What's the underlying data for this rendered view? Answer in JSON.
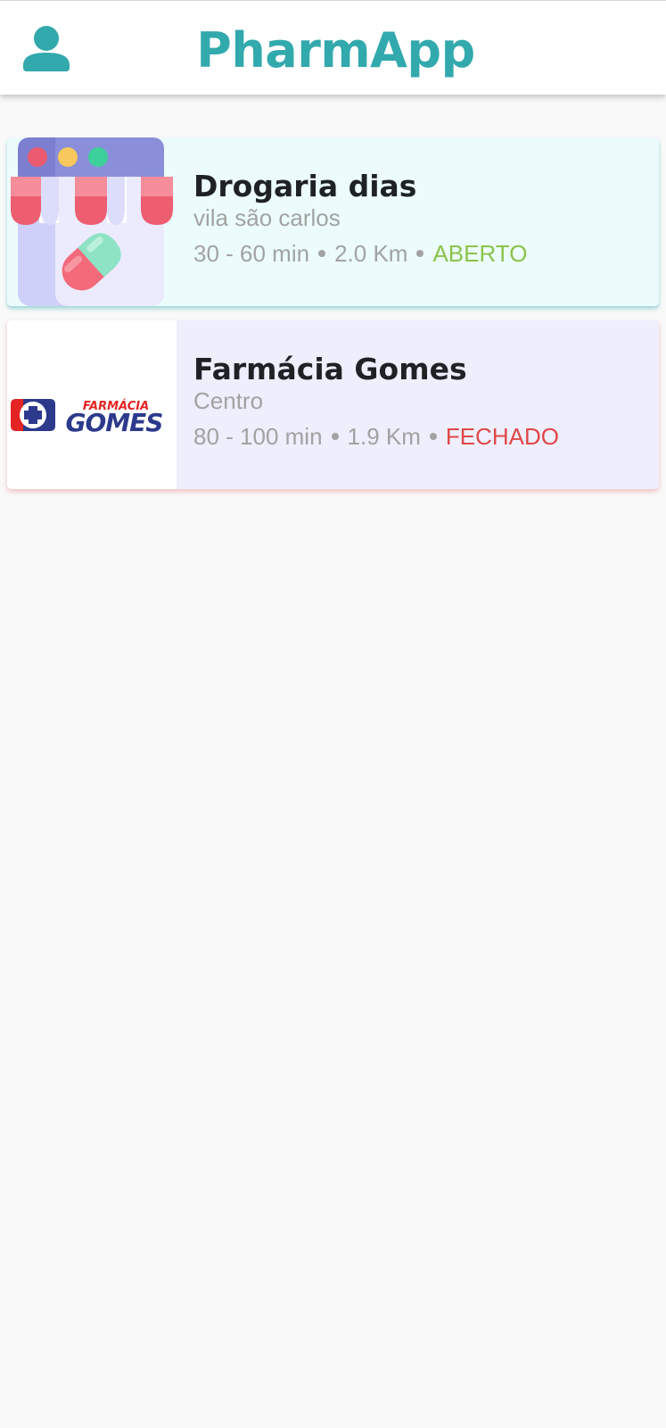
{
  "app": {
    "title": "PharmApp",
    "accent_color": "#32a9ad",
    "profile_icon": "user-icon"
  },
  "pharmacies": [
    {
      "name": "Drogaria dias",
      "area": "vila são carlos",
      "time": "30 - 60 min",
      "distance": "2.0 Km",
      "status": "ABERTO",
      "status_color": "#8bc34a",
      "card_color": "#ecfcfc",
      "image": "storefront-pill-icon"
    },
    {
      "name": "Farmácia Gomes",
      "area": "Centro",
      "time": "80 - 100 min",
      "distance": "1.9 Km",
      "status": "FECHADO",
      "status_color": "#e04848",
      "card_color": "#eeeefd",
      "image": "farmacia-gomes-logo",
      "logo_text": {
        "line1": "FARMÁCIA",
        "line2": "GOMES"
      }
    }
  ]
}
